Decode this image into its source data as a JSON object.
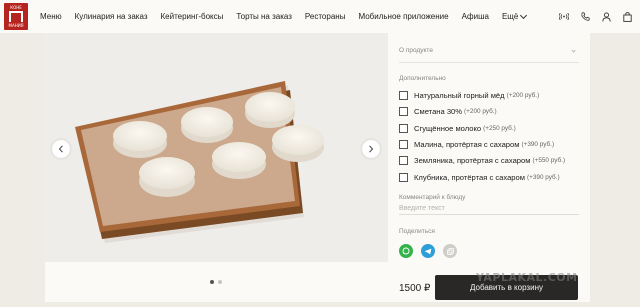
{
  "brand": {
    "logo_text_top": "КОНЕ",
    "logo_text_bottom": "МАНИЯ",
    "colors": {
      "brand_red": "#b5241f",
      "button_dark": "#2a2826",
      "whatsapp": "#33b34a",
      "telegram": "#2d9ed8"
    }
  },
  "nav": {
    "items": [
      {
        "label": "Меню"
      },
      {
        "label": "Кулинария на заказ"
      },
      {
        "label": "Кейтеринг-боксы"
      },
      {
        "label": "Торты на заказ"
      },
      {
        "label": "Рестораны"
      },
      {
        "label": "Мобильное приложение"
      },
      {
        "label": "Афиша"
      }
    ],
    "more_label": "Ещё",
    "icons": [
      "broadcast-icon",
      "phone-icon",
      "user-icon",
      "bag-icon"
    ]
  },
  "gallery": {
    "slide_index": 1,
    "slides_total": 2,
    "image_description_icon": "cheese-pancakes-photo"
  },
  "product": {
    "about_label": "О продукте",
    "extras_title": "Дополнительно",
    "extras": [
      {
        "name": "Натуральный горный мёд",
        "price": "(+200 руб.)"
      },
      {
        "name": "Сметана 30%",
        "price": "(+200 руб.)"
      },
      {
        "name": "Сгущённое молоко",
        "price": "(+250 руб.)"
      },
      {
        "name": "Малина, протёртая с сахаром",
        "price": "(+390 руб.)"
      },
      {
        "name": "Земляника, протёртая с сахаром",
        "price": "(+550 руб.)"
      },
      {
        "name": "Клубника, протёртая с сахаром",
        "price": "(+390 руб.)"
      }
    ],
    "comment_label": "Комментарий к блюду",
    "comment_placeholder": "Введите текст",
    "share_label": "Поделиться",
    "price": "1500 ₽",
    "add_to_cart": "Добавить в корзину"
  },
  "watermark": "YAPLAKAL.COM"
}
